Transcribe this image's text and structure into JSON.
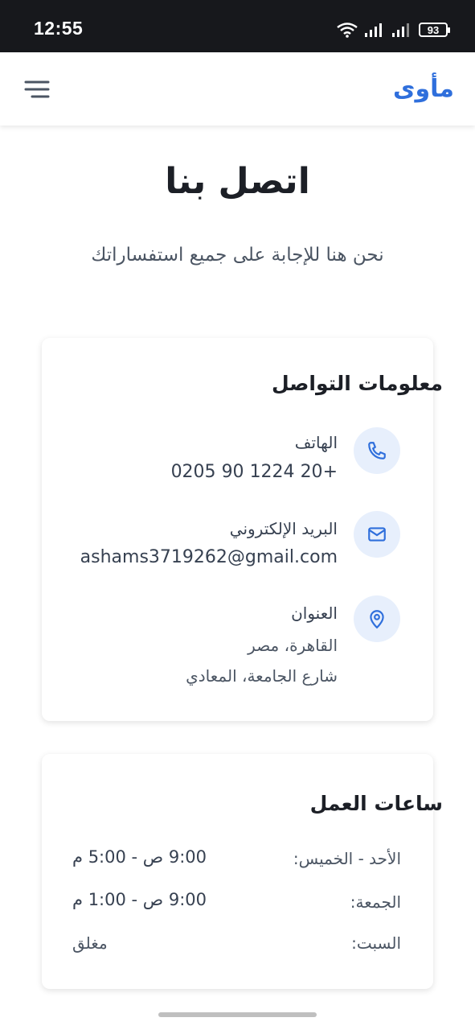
{
  "status_bar": {
    "time": "12:55",
    "battery": "93"
  },
  "header": {
    "logo": "مأوى",
    "menu_icon": "hamburger-menu-icon",
    "accent_color": "#2f6fdc"
  },
  "page": {
    "title": "اتصل بنا",
    "subtitle": "نحن هنا للإجابة على جميع استفساراتك"
  },
  "contact_card": {
    "title": "معلومات التواصل",
    "phone": {
      "icon": "phone-icon",
      "label": "الهاتف",
      "value": "+20 1224 90 0205"
    },
    "email": {
      "icon": "mail-icon",
      "label": "البريد الإلكتروني",
      "value": "ashams3719262@gmail.com"
    },
    "address": {
      "icon": "map-pin-icon",
      "label": "العنوان",
      "line1": "القاهرة، مصر",
      "line2": "شارع الجامعة، المعادي"
    }
  },
  "hours_card": {
    "title": "ساعات العمل",
    "rows": [
      {
        "day": "الأحد - الخميس:",
        "time": "9:00 ص - 5:00 م"
      },
      {
        "day": "الجمعة:",
        "time": "9:00 ص - 1:00 م"
      },
      {
        "day": "السبت:",
        "time": "مغلق"
      }
    ]
  }
}
